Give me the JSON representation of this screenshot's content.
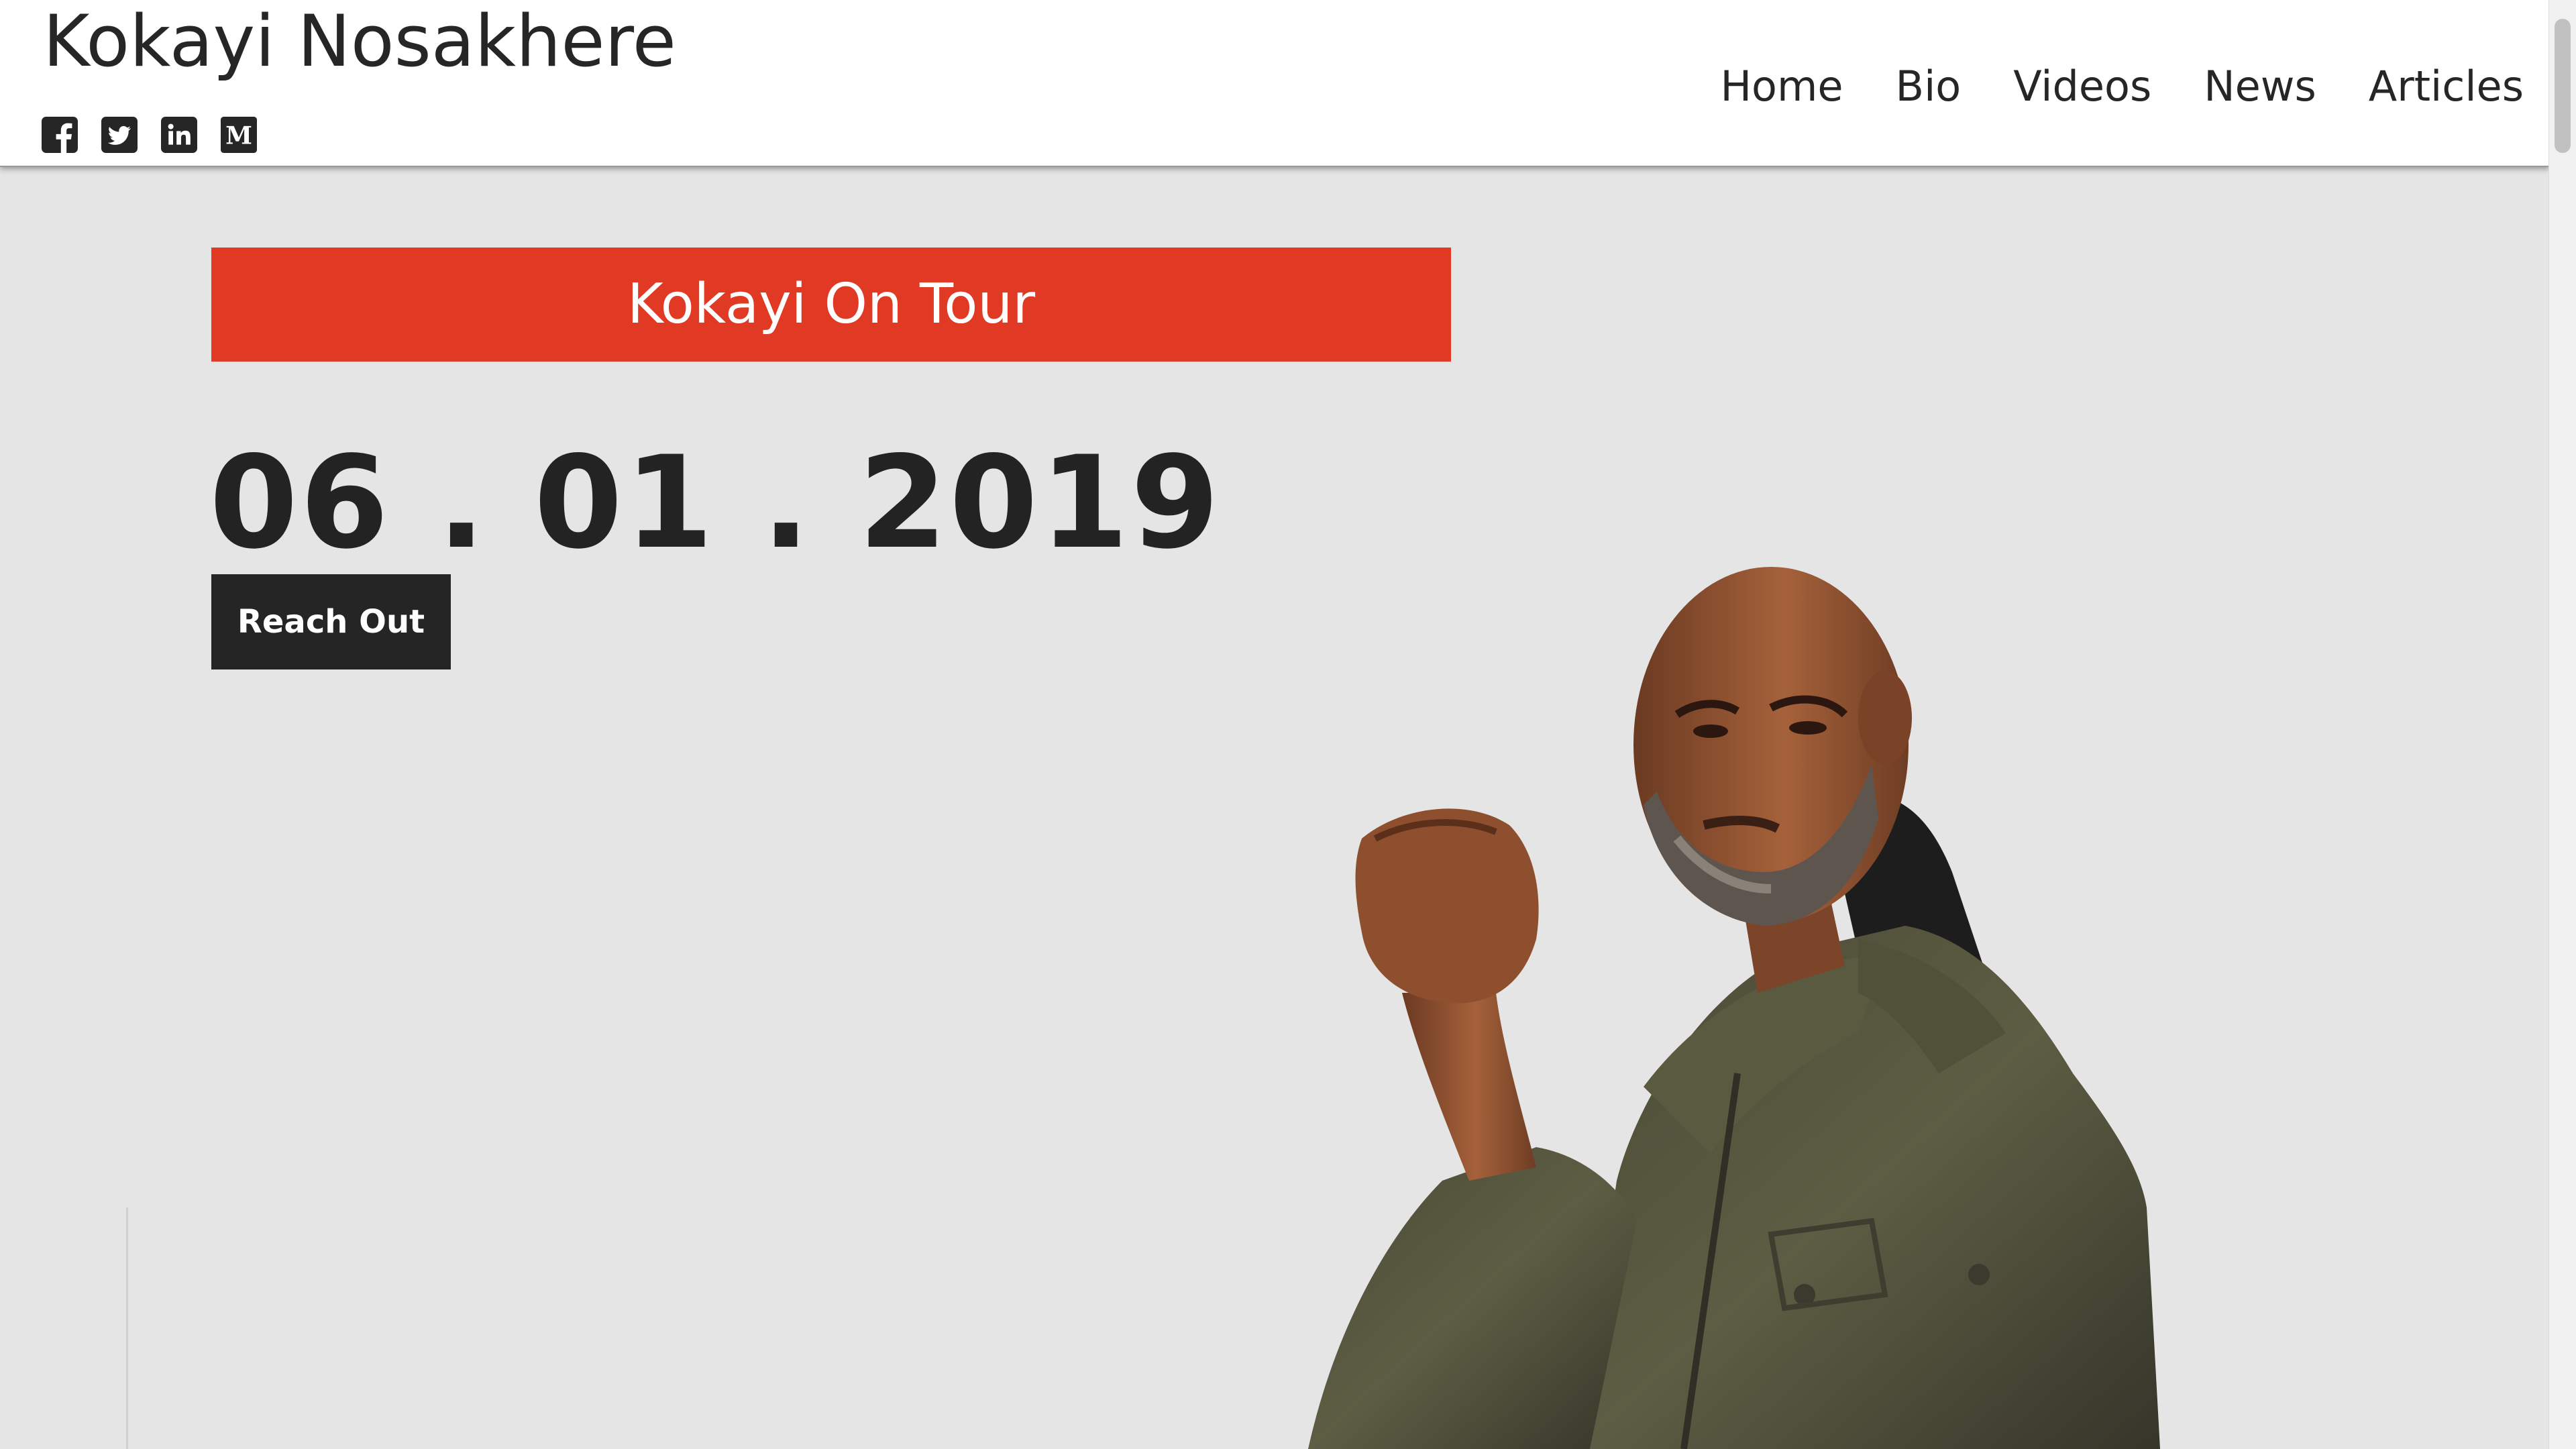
{
  "header": {
    "site_title": "Kokayi Nosakhere",
    "social_icons": [
      "facebook-icon",
      "twitter-icon",
      "linkedin-icon",
      "medium-icon"
    ],
    "nav": [
      "Home",
      "Bio",
      "Videos",
      "News",
      "Articles"
    ]
  },
  "hero": {
    "banner": "Kokayi On Tour",
    "date": "06 . 01 . 2019",
    "cta_label": "Reach Out"
  },
  "colors": {
    "accent": "#e03a25",
    "background": "#e5e5e5",
    "text": "#222222",
    "button": "#252525"
  }
}
